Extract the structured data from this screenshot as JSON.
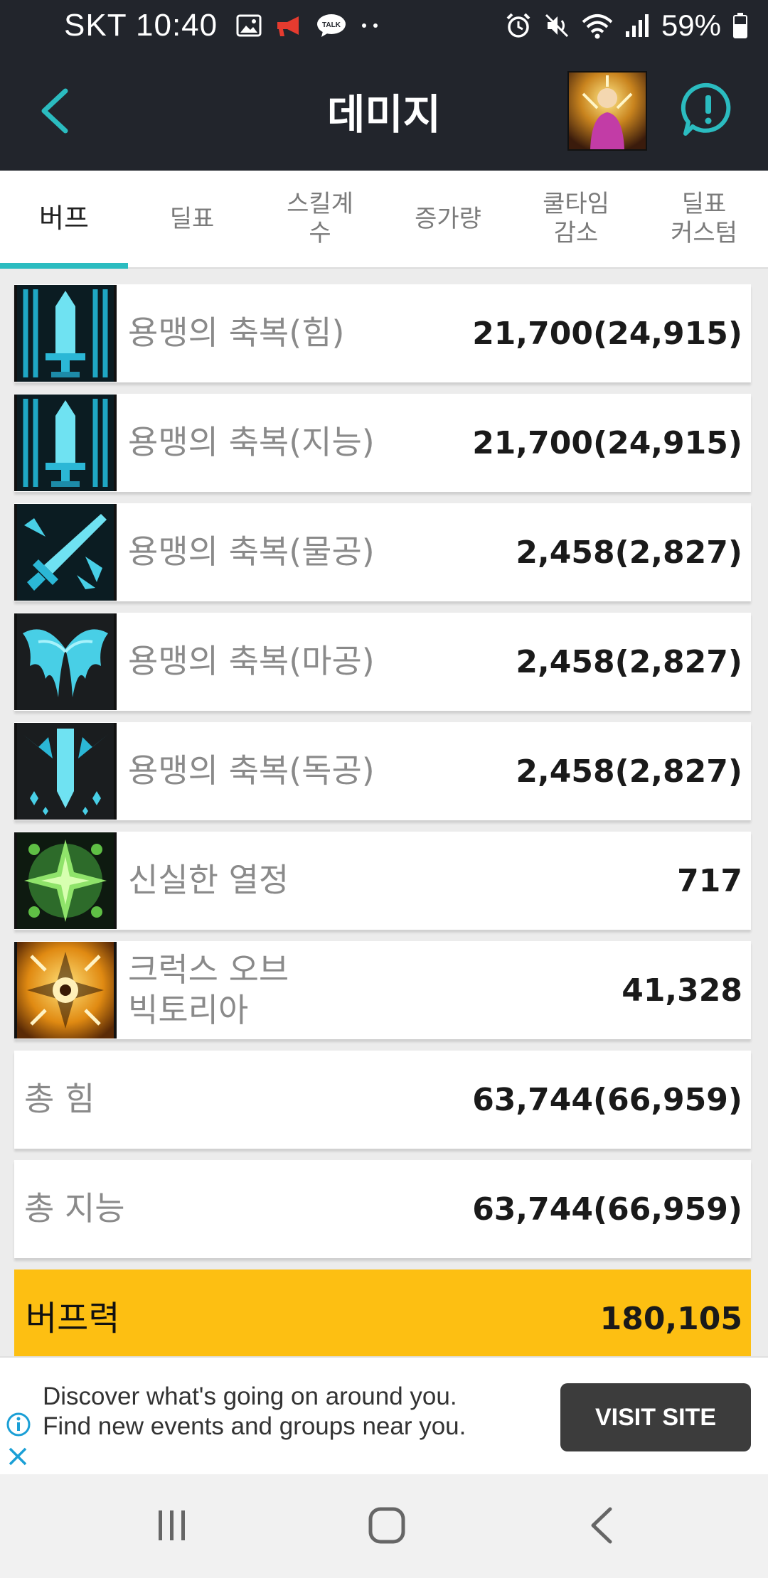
{
  "status_bar": {
    "carrier_time": "SKT 10:40",
    "battery": "59%"
  },
  "app_bar": {
    "title": "데미지"
  },
  "tabs": [
    {
      "label": "버프",
      "active": true
    },
    {
      "label": "딜표"
    },
    {
      "label": "스킬계\n수"
    },
    {
      "label": "증가량"
    },
    {
      "label": "쿨타임\n감소"
    },
    {
      "label": "딜표\n커스텀"
    }
  ],
  "buffs": [
    {
      "name": "용맹의 축복(힘)",
      "value": "21,700(24,915)",
      "icon": "blessing-sword-icon"
    },
    {
      "name": "용맹의 축복(지능)",
      "value": "21,700(24,915)",
      "icon": "blessing-sword-icon"
    },
    {
      "name": "용맹의 축복(물공)",
      "value": "2,458(2,827)",
      "icon": "crossed-blades-icon"
    },
    {
      "name": "용맹의 축복(마공)",
      "value": "2,458(2,827)",
      "icon": "wings-icon"
    },
    {
      "name": "용맹의 축복(독공)",
      "value": "2,458(2,827)",
      "icon": "spiked-sword-icon"
    },
    {
      "name": "신실한 열정",
      "value": "717",
      "icon": "green-cross-icon"
    },
    {
      "name": "크럭스 오브\n빅토리아",
      "value": "41,328",
      "icon": "golden-sigil-icon"
    }
  ],
  "totals": [
    {
      "name": "총 힘",
      "value": "63,744(66,959)"
    },
    {
      "name": "총 지능",
      "value": "63,744(66,959)"
    }
  ],
  "buff_power": {
    "name": "버프력",
    "value": "180,105"
  },
  "ad": {
    "line1": "Discover what's going on around you.",
    "line2": "Find new events and groups near you.",
    "button": "VISIT SITE"
  },
  "colors": {
    "header_bg": "#22252c",
    "accent": "#2bbcc0",
    "buff_power_bg": "#fdbf12"
  }
}
